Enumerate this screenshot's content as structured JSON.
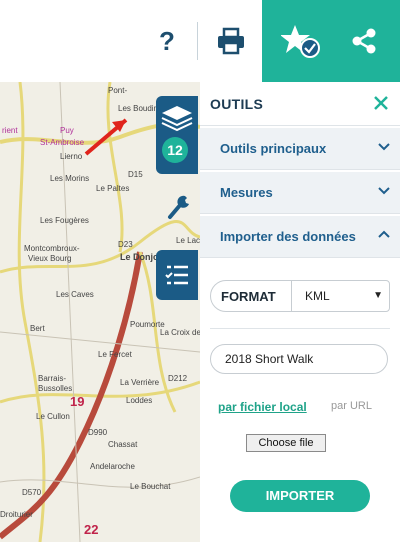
{
  "toolbar": {
    "help_label": "?",
    "help_icon": "question-mark-icon",
    "print_icon": "printer-icon",
    "favorite_icon": "star-check-icon",
    "share_icon": "share-icon",
    "accent": "#1fb39a"
  },
  "map": {
    "labels": [
      "Pont-",
      "Les Boudins",
      "rient",
      "Puy",
      "St-Ambroise",
      "Lierno",
      "Les Morins",
      "Le Paltes",
      "Les Fougères",
      "Montcombroux-",
      "Vieux Bourg",
      "Le Donjon",
      "Le Lac",
      "Les Caves",
      "Bert",
      "Le Fercet",
      "Poumorte",
      "La Croix de la Baie",
      "Barrais-",
      "Bussolles",
      "La Verrière",
      "Loddes",
      "Le Cullon",
      "Chassat",
      "Andelaroche",
      "Le Bouchat",
      "Droiturier"
    ],
    "numbers": [
      "19",
      "22"
    ],
    "roads": [
      "D15",
      "D23",
      "D212",
      "D990",
      "D570"
    ],
    "layers_count": "12",
    "layers_icon": "layers-icon",
    "tools_icon": "wrench-icon",
    "legend_icon": "legend-list-icon"
  },
  "panel": {
    "title": "OUTILS",
    "close_icon": "close-icon",
    "sections": [
      {
        "label": "Outils principaux",
        "state": "collapsed"
      },
      {
        "label": "Mesures",
        "state": "collapsed"
      },
      {
        "label": "Importer des données",
        "state": "expanded"
      }
    ],
    "format_label": "FORMAT",
    "format_value": "KML",
    "name_value": "2018 Short Walk",
    "source_local": "par fichier local",
    "source_url": "par URL",
    "choose_file": "Choose file",
    "import_label": "IMPORTER"
  }
}
